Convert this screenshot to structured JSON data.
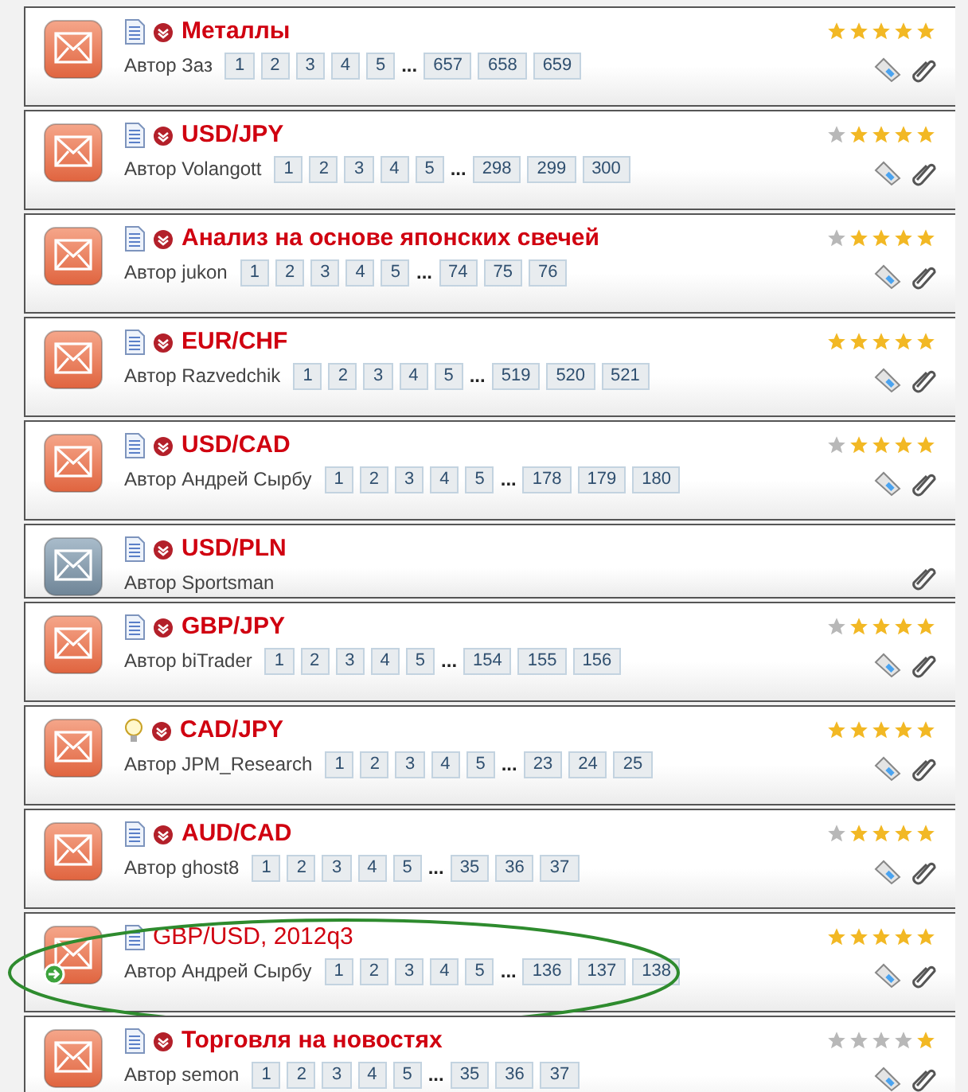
{
  "topics": [
    {
      "title": "Металлы",
      "author": "Автор Заз",
      "pages": [
        "1",
        "2",
        "3",
        "4",
        "5",
        "...",
        "657",
        "658",
        "659"
      ],
      "stars": 5,
      "unread": true,
      "kind": "document",
      "hot": true,
      "bold": true,
      "tags": true,
      "moved": false,
      "highlighted": false
    },
    {
      "title": "USD/JPY",
      "author": "Автор Volangott",
      "pages": [
        "1",
        "2",
        "3",
        "4",
        "5",
        "...",
        "298",
        "299",
        "300"
      ],
      "stars": 4,
      "unread": true,
      "kind": "document",
      "hot": true,
      "bold": true,
      "tags": true,
      "moved": false,
      "highlighted": false
    },
    {
      "title": "Анализ на основе японских свечей",
      "author": "Автор jukon",
      "pages": [
        "1",
        "2",
        "3",
        "4",
        "5",
        "...",
        "74",
        "75",
        "76"
      ],
      "stars": 4,
      "unread": true,
      "kind": "document",
      "hot": true,
      "bold": true,
      "tags": true,
      "moved": false,
      "highlighted": false
    },
    {
      "title": "EUR/CHF",
      "author": "Автор Razvedchik",
      "pages": [
        "1",
        "2",
        "3",
        "4",
        "5",
        "...",
        "519",
        "520",
        "521"
      ],
      "stars": 5,
      "unread": true,
      "kind": "document",
      "hot": true,
      "bold": true,
      "tags": true,
      "moved": false,
      "highlighted": false
    },
    {
      "title": "USD/CAD",
      "author": "Автор Андрей Сырбу",
      "pages": [
        "1",
        "2",
        "3",
        "4",
        "5",
        "...",
        "178",
        "179",
        "180"
      ],
      "stars": 4,
      "unread": true,
      "kind": "document",
      "hot": true,
      "bold": true,
      "tags": true,
      "moved": false,
      "highlighted": false
    },
    {
      "title": "USD/PLN",
      "author": "Автор Sportsman",
      "unread": false,
      "kind": "document",
      "hot": true,
      "bold": true,
      "tags": false,
      "moved": false,
      "highlighted": false
    },
    {
      "title": "GBP/JPY",
      "author": "Автор biTrader",
      "pages": [
        "1",
        "2",
        "3",
        "4",
        "5",
        "...",
        "154",
        "155",
        "156"
      ],
      "stars": 4,
      "unread": true,
      "kind": "document",
      "hot": true,
      "bold": true,
      "tags": true,
      "moved": false,
      "highlighted": false
    },
    {
      "title": "CAD/JPY",
      "author": "Автор JPM_Research",
      "pages": [
        "1",
        "2",
        "3",
        "4",
        "5",
        "...",
        "23",
        "24",
        "25"
      ],
      "stars": 5,
      "unread": true,
      "kind": "idea",
      "hot": true,
      "bold": true,
      "tags": true,
      "moved": false,
      "highlighted": false
    },
    {
      "title": "AUD/CAD",
      "author": "Автор ghost8",
      "pages": [
        "1",
        "2",
        "3",
        "4",
        "5",
        "...",
        "35",
        "36",
        "37"
      ],
      "stars": 4,
      "unread": true,
      "kind": "document",
      "hot": true,
      "bold": true,
      "tags": true,
      "moved": false,
      "highlighted": false
    },
    {
      "title": "GBP/USD, 2012q3",
      "author": "Автор Андрей Сырбу",
      "pages": [
        "1",
        "2",
        "3",
        "4",
        "5",
        "...",
        "136",
        "137",
        "138"
      ],
      "stars": 5,
      "unread": true,
      "kind": "document",
      "hot": false,
      "bold": false,
      "tags": true,
      "moved": true,
      "highlighted": true
    },
    {
      "title": "Торговля на новостях",
      "author": "Автор semon",
      "pages": [
        "1",
        "2",
        "3",
        "4",
        "5",
        "...",
        "35",
        "36",
        "37"
      ],
      "stars": 1,
      "unread": true,
      "kind": "document",
      "hot": true,
      "bold": true,
      "tags": true,
      "moved": false,
      "highlighted": false
    }
  ]
}
